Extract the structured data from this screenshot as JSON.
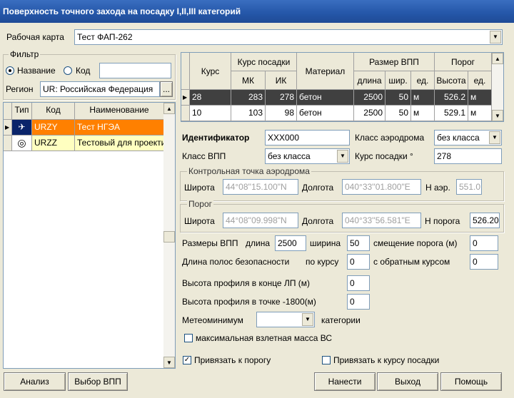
{
  "window": {
    "title": "Поверхность точного захода на посадку I,II,III категорий"
  },
  "map": {
    "label": "Рабочая карта",
    "value": "Тест ФАП-262"
  },
  "filter": {
    "title": "Фильтр",
    "by_name": "Название",
    "by_code": "Код",
    "search_value": "",
    "region_label": "Регион",
    "region_value": "UR: Российская Федерация",
    "region_button": "..."
  },
  "aerodromes": {
    "columns": [
      "Тип",
      "Код",
      "Наименование"
    ],
    "rows": [
      {
        "code": "URZY",
        "name": "Тест НГЭА",
        "icon": "aircraft-icon"
      },
      {
        "code": "URZZ",
        "name": "Тестовый для проекти",
        "icon": "target-icon"
      }
    ]
  },
  "runways": {
    "headers": {
      "course": "Курс",
      "landing_course": "Курс посадки",
      "mk": "МК",
      "ik": "ИК",
      "material": "Материал",
      "size": "Размер ВПП",
      "length": "длина",
      "width": "шир.",
      "unit": "ед.",
      "threshold": "Порог",
      "height": "Высота",
      "unit2": "ед."
    },
    "rows": [
      {
        "course": "28",
        "mk": "283",
        "ik": "278",
        "material": "бетон",
        "length": "2500",
        "width": "50",
        "unit": "м",
        "height": "526.2",
        "unit2": "м"
      },
      {
        "course": "10",
        "mk": "103",
        "ik": "98",
        "material": "бетон",
        "length": "2500",
        "width": "50",
        "unit": "м",
        "height": "529.1",
        "unit2": "м"
      }
    ]
  },
  "form": {
    "identifier_label": "Идентификатор",
    "identifier_value": "XXX000",
    "aerodrome_class_label": "Класс аэродрома",
    "aerodrome_class_value": "без класса",
    "runway_class_label": "Класс ВПП",
    "runway_class_value": "без класса",
    "landing_course_label": "Курс посадки °",
    "landing_course_value": "278",
    "control_point": {
      "title": "Контрольная точка аэродрома",
      "lat_label": "Широта",
      "lat_value": "44°08''15.100\"N",
      "lon_label": "Долгота",
      "lon_value": "040°33''01.800\"E",
      "h_label": "Н аэр.",
      "h_value": "551.0"
    },
    "threshold": {
      "title": "Порог",
      "lat_label": "Широта",
      "lat_value": "44°08''09.998\"N",
      "lon_label": "Долгота",
      "lon_value": "040°33''56.581\"E",
      "h_label": "Н порога",
      "h_value": "526.20"
    },
    "sizes_label": "Размеры ВПП",
    "length_label": "длина",
    "length_value": "2500",
    "width_label": "ширина",
    "width_value": "50",
    "offset_label": "смещение порога (м)",
    "offset_value": "0",
    "strip_label": "Длина полос безопасности",
    "by_course_label": "по курсу",
    "by_course_value": "0",
    "reverse_label": "с обратным курсом",
    "reverse_value": "0",
    "profile_end_label": "Высота профиля в конце ЛП (м)",
    "profile_end_value": "0",
    "profile_point_label": "Высота профиля в точке -1800(м)",
    "profile_point_value": "0",
    "meteo_label": "Метеоминимум",
    "meteo_value": "",
    "category_label": "категории",
    "max_mass_label": "максимальная взлетная масса ВС",
    "max_mass_checked": false,
    "bind_threshold_label": "Привязать к порогу",
    "bind_threshold_checked": true,
    "bind_course_label": "Привязать к курсу посадки",
    "bind_course_checked": false
  },
  "buttons": {
    "analysis": "Анализ",
    "select_runway": "Выбор ВПП",
    "apply": "Нанести",
    "exit": "Выход",
    "help": "Помощь"
  },
  "colors": {
    "selected_row": "#ff8000",
    "second_row": "#ffffc0",
    "titlebar": "#2456a8",
    "grid_selected": "#404040"
  }
}
